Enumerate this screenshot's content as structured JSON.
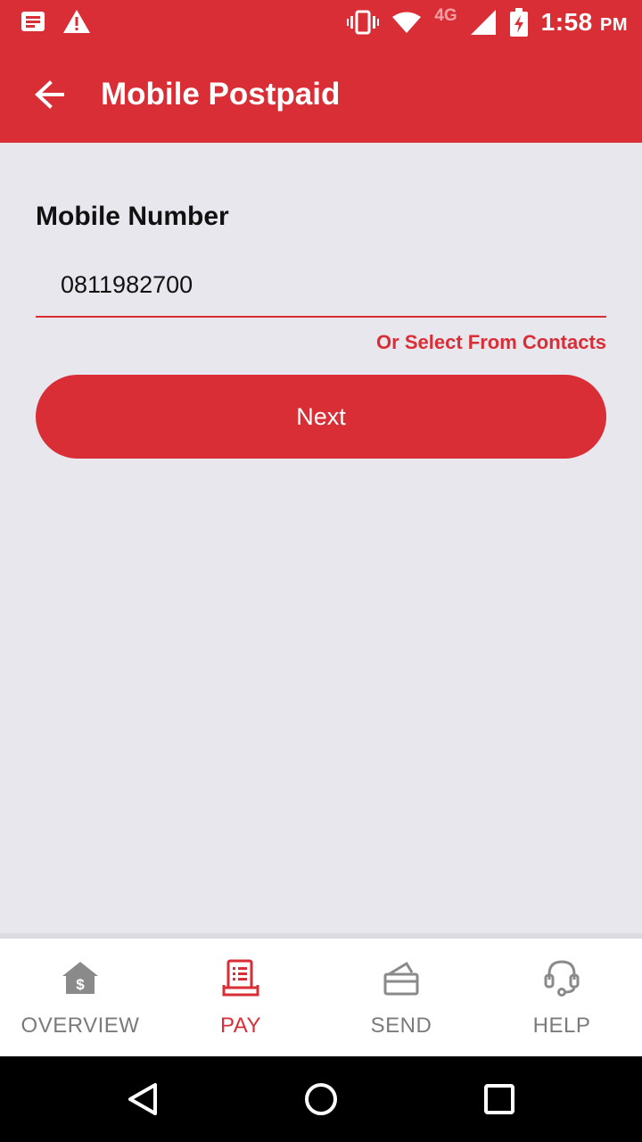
{
  "status_bar": {
    "time": "1:58",
    "ampm": "PM",
    "network": "4G"
  },
  "header": {
    "title": "Mobile Postpaid"
  },
  "form": {
    "label": "Mobile Number",
    "value": "0811982700",
    "contacts_link": "Or Select From Contacts",
    "next_label": "Next"
  },
  "bottom_nav": {
    "tabs": [
      {
        "label": "OVERVIEW",
        "icon": "house-dollar-icon",
        "active": false
      },
      {
        "label": "PAY",
        "icon": "receipt-icon",
        "active": true
      },
      {
        "label": "SEND",
        "icon": "card-send-icon",
        "active": false
      },
      {
        "label": "HELP",
        "icon": "headset-icon",
        "active": false
      }
    ]
  },
  "colors": {
    "accent": "#d92e36",
    "background": "#e8e7ee",
    "inactive": "#7b7b7b"
  }
}
